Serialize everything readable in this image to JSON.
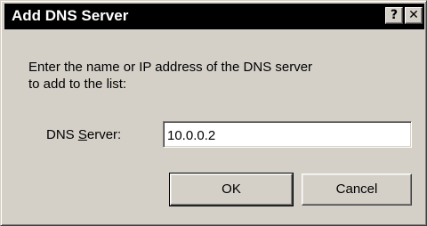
{
  "window": {
    "title": "Add DNS Server",
    "help_label": "?",
    "close_label": "✕"
  },
  "message": {
    "line1": "Enter the name or IP address of the DNS server",
    "line2": "to add to the list:"
  },
  "field": {
    "label_prefix": "DNS ",
    "label_access_key": "S",
    "label_suffix": "erver:",
    "value": "10.0.0.2"
  },
  "buttons": {
    "ok_label": "OK",
    "cancel_label": "Cancel"
  }
}
